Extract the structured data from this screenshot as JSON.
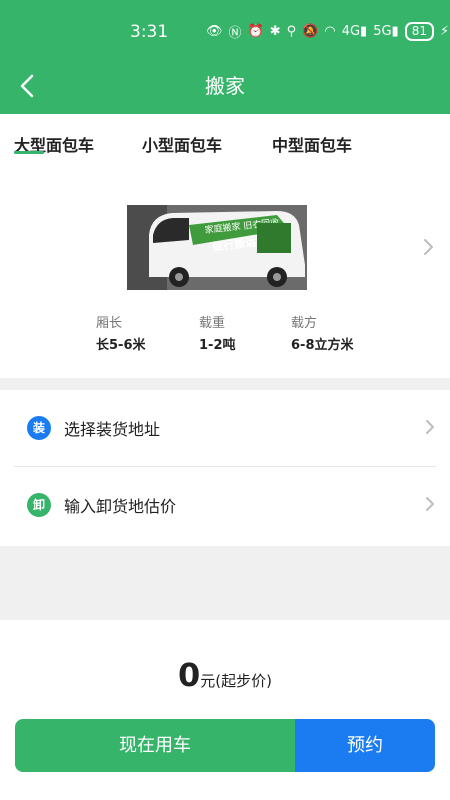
{
  "status_bar": {
    "time": "3:31",
    "battery": "81",
    "icons": [
      "eye-icon",
      "nfc-icon",
      "alarm-icon",
      "bluetooth-icon",
      "location-icon",
      "mute-icon",
      "wifi-icon",
      "signal-4g-icon",
      "signal-5g-icon",
      "charging-icon"
    ]
  },
  "header": {
    "title": "搬家"
  },
  "tabs": [
    {
      "label": "大型面包车",
      "active": true
    },
    {
      "label": "小型面包车",
      "active": false
    },
    {
      "label": "中型面包车",
      "active": false
    }
  ],
  "van": {
    "banner_text_1": "家庭搬家 旧衣回收",
    "banner_text_2": "蚁行搬运队"
  },
  "specs": [
    {
      "label": "厢长",
      "value": "长5-6米"
    },
    {
      "label": "载重",
      "value": "1-2吨"
    },
    {
      "label": "载方",
      "value": "6-8立方米"
    }
  ],
  "address": {
    "load": {
      "badge": "装",
      "text": "选择装货地址",
      "color": "#1a7cf0"
    },
    "unload": {
      "badge": "卸",
      "text": "输入卸货地估价",
      "color": "#36b46a"
    }
  },
  "price": {
    "amount": "0",
    "unit": "元(起步价)"
  },
  "actions": {
    "now": "现在用车",
    "book": "预约"
  },
  "colors": {
    "primary": "#36b46a",
    "accent": "#1a7cf0"
  }
}
